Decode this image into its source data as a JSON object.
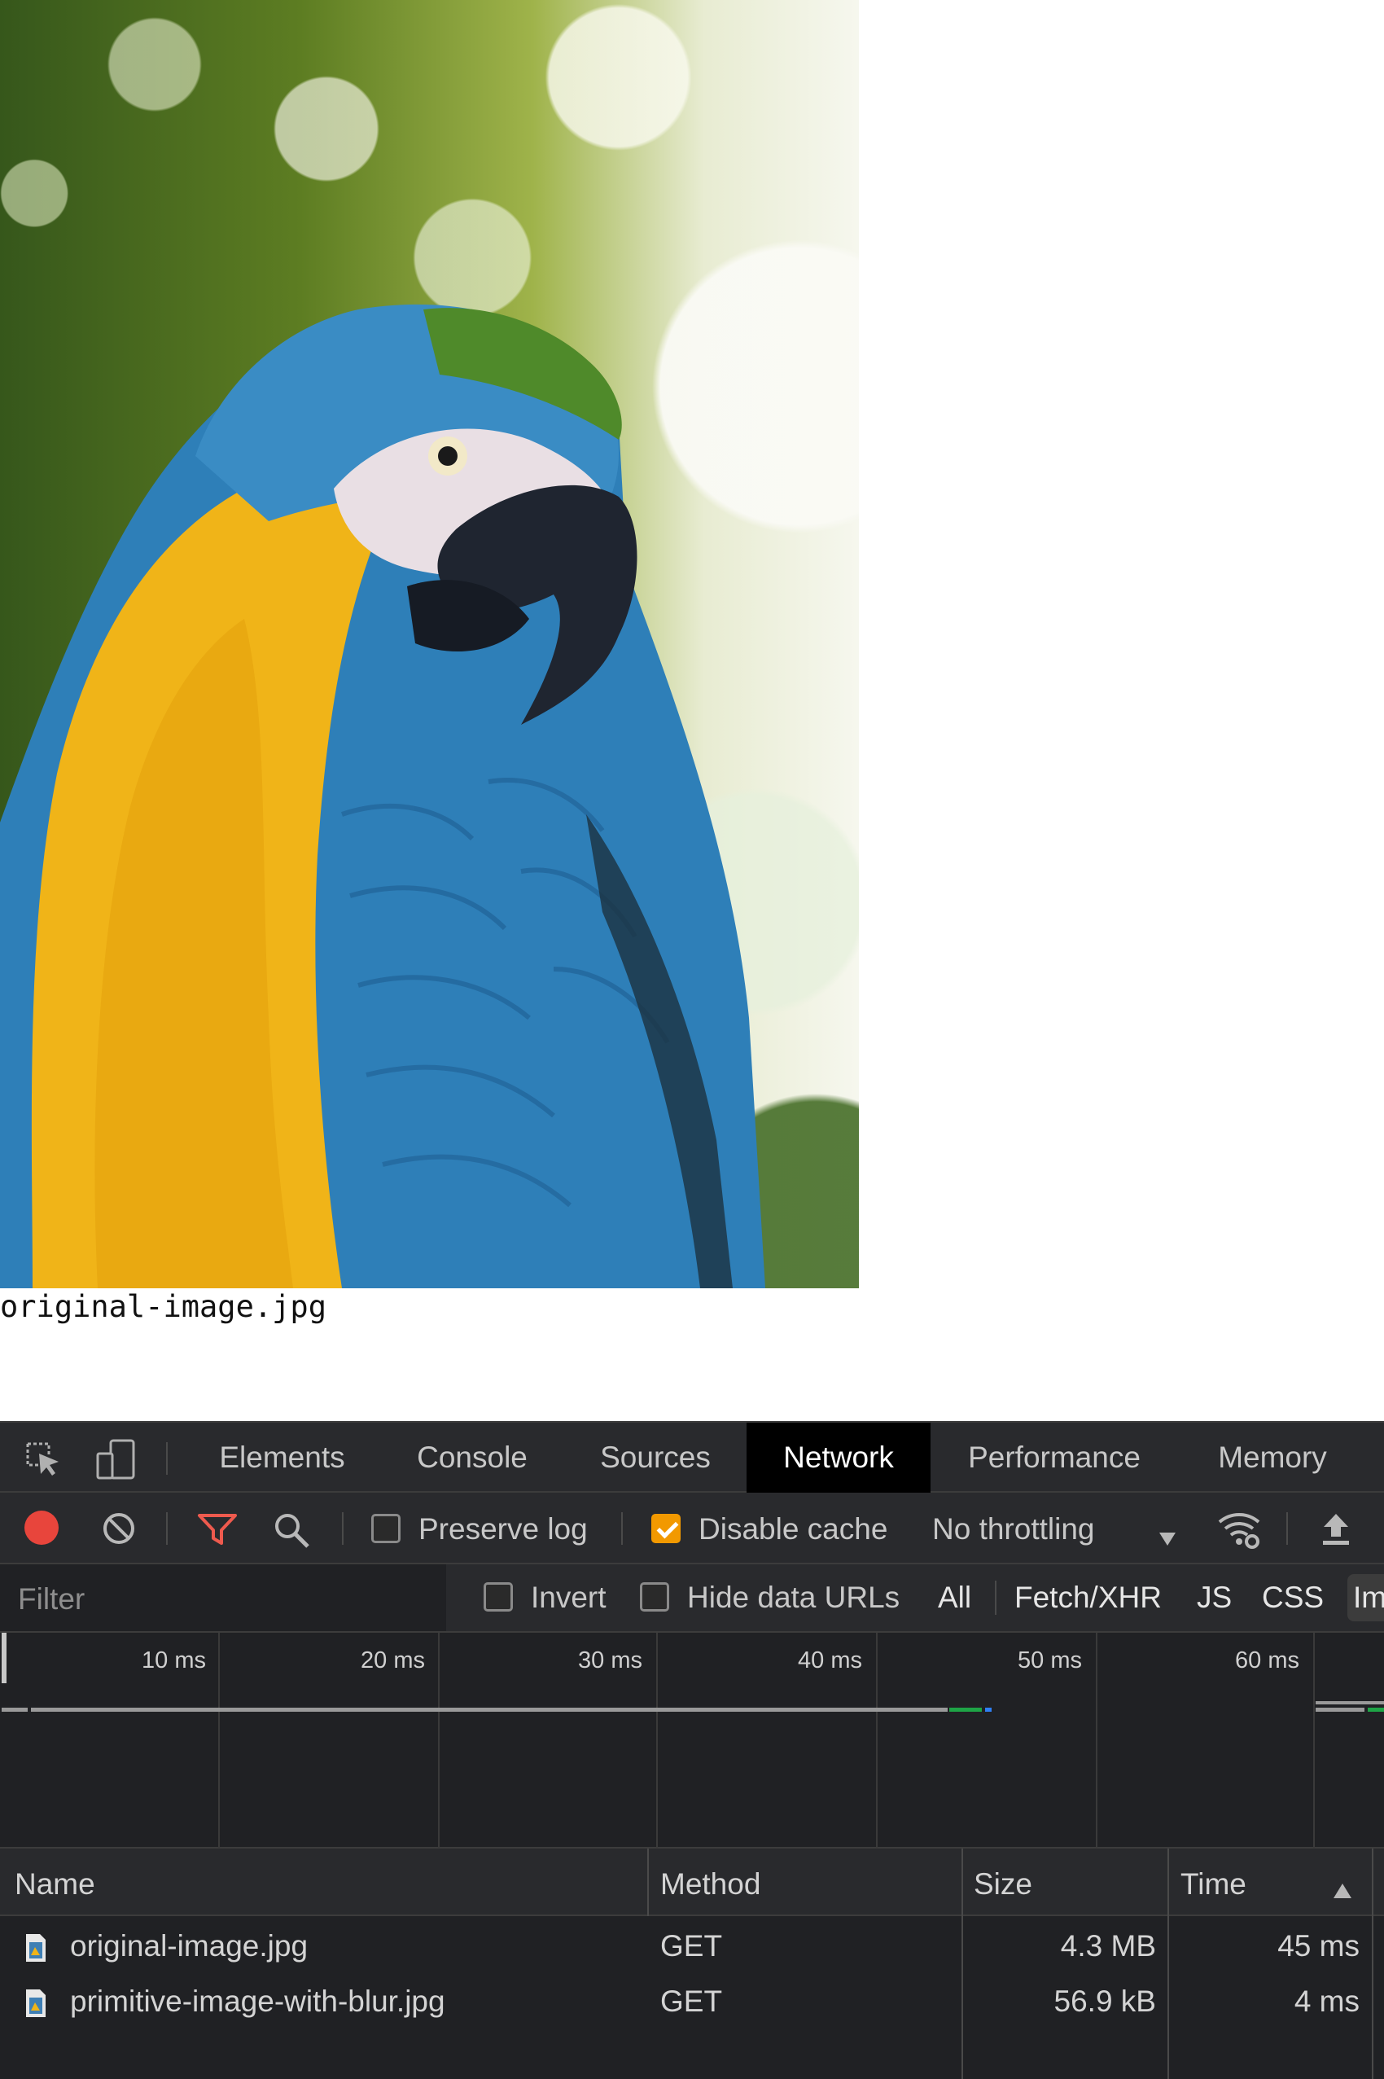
{
  "page": {
    "image_caption": "original-image.jpg"
  },
  "devtools": {
    "tabs": [
      {
        "label": "Elements"
      },
      {
        "label": "Console"
      },
      {
        "label": "Sources"
      },
      {
        "label": "Network"
      },
      {
        "label": "Performance"
      },
      {
        "label": "Memory"
      }
    ],
    "active_tab": "Network",
    "toolbar": {
      "record_icon": "record-icon",
      "clear_icon": "clear-icon",
      "filter_icon": "filter-icon",
      "search_icon": "search-icon",
      "preserve_log": {
        "label": "Preserve log",
        "checked": false
      },
      "disable_cache": {
        "label": "Disable cache",
        "checked": true
      },
      "throttling": "No throttling",
      "network_conditions_icon": "wifi-settings-icon",
      "import_icon": "upload-icon"
    },
    "filterbar": {
      "placeholder": "Filter",
      "invert": {
        "label": "Invert",
        "checked": false
      },
      "hide_data_urls": {
        "label": "Hide data URLs",
        "checked": false
      },
      "types": [
        "All",
        "Fetch/XHR",
        "JS",
        "CSS",
        "Im"
      ]
    },
    "overview": {
      "ticks": [
        "10 ms",
        "20 ms",
        "30 ms",
        "40 ms",
        "50 ms",
        "60 ms"
      ]
    },
    "table": {
      "columns": [
        "Name",
        "Method",
        "Size",
        "Time"
      ],
      "sort_icon": "sort-ascending-icon",
      "rows": [
        {
          "name": "original-image.jpg",
          "method": "GET",
          "size": "4.3 MB",
          "time": "45 ms"
        },
        {
          "name": "primitive-image-with-blur.jpg",
          "method": "GET",
          "size": "56.9 kB",
          "time": "4 ms"
        }
      ]
    },
    "colors": {
      "accent_orange": "#f29900",
      "record_red": "#e8453c",
      "filter_red": "#ee5a4e",
      "waterfall_green": "#1ea446",
      "waterfall_blue": "#2f7ff4"
    }
  }
}
